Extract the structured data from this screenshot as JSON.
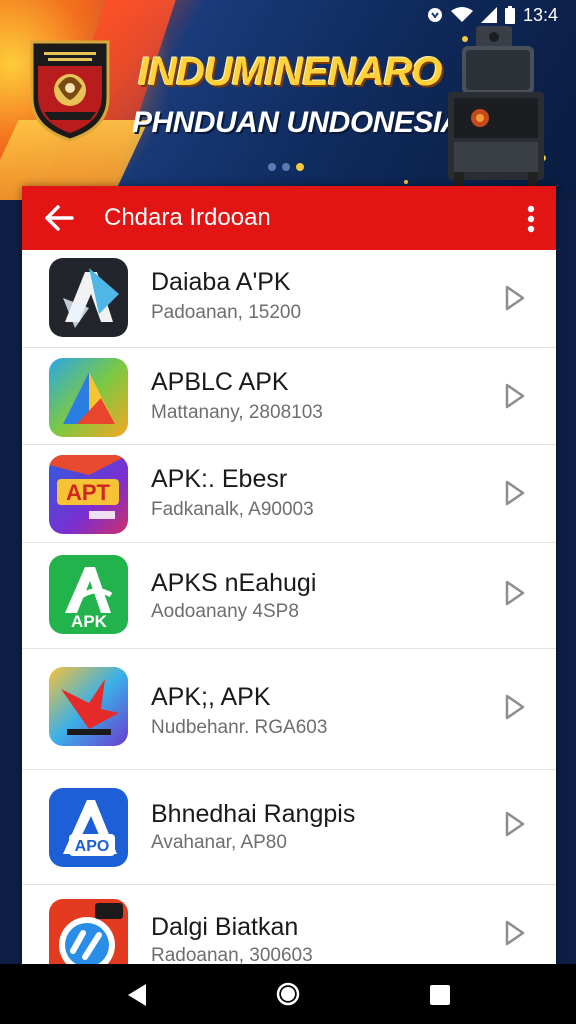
{
  "status_bar": {
    "time": "13:4",
    "icons": [
      "notification-icon",
      "wifi-icon",
      "signal-icon",
      "battery-icon"
    ]
  },
  "banner": {
    "title": "INDUMINENARO",
    "subtitle": "PHNDUAN UNDONESIA",
    "carousel_total": 4,
    "carousel_active": 3,
    "title_color": "#ffd23a"
  },
  "app_bar": {
    "title": "Chdara Irdooan",
    "color": "#e31414"
  },
  "apps": [
    {
      "name": "Daiaba A'PK",
      "subtitle": "Padoanan, 15200",
      "icon": "app-icon-dark-a"
    },
    {
      "name": "APBLC APK",
      "subtitle": "Mattanany, 2808103",
      "icon": "app-icon-rainbow-triangle"
    },
    {
      "name": "APK:. Ebesr",
      "subtitle": "Fadkanalk, A90003",
      "icon": "app-icon-apt"
    },
    {
      "name": "APKS nEahugi",
      "subtitle": "Aodoanany 4SP8",
      "icon": "app-icon-green-apk"
    },
    {
      "name": "APK;, APK",
      "subtitle": "Nudbehanr. RGA603",
      "icon": "app-icon-red-bird"
    },
    {
      "name": "Bhnedhai Rangpis",
      "subtitle": "Avahanar, AP80",
      "icon": "app-icon-blue-apo"
    },
    {
      "name": "Dalgi Biatkan",
      "subtitle": "Radoanan, 300603",
      "icon": "app-icon-red-badge"
    }
  ],
  "nav_bar": {
    "buttons": [
      "back-icon",
      "home-icon",
      "recents-icon"
    ]
  }
}
